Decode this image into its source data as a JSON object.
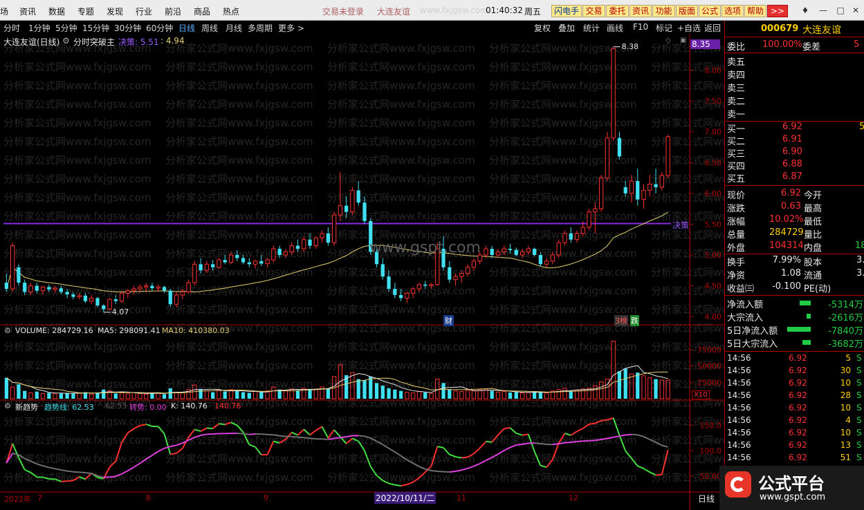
{
  "menubar": {
    "items": [
      "场",
      "资讯",
      "数据",
      "专题",
      "发现",
      "行业",
      "前沿",
      "商品",
      "热点"
    ],
    "status_login": "交易未登录",
    "status_stock": "大连友谊",
    "watermark_url": "www.fxjgsw.com",
    "time": "01:40:32",
    "weekday": "周五",
    "buttons": [
      "闪电手",
      "交易",
      "委托",
      "资讯",
      "功能",
      "版面",
      "公式",
      "选项",
      "帮助",
      ">>"
    ]
  },
  "toolbar": {
    "periods": [
      "分时",
      "1分钟",
      "5分钟",
      "15分钟",
      "30分钟",
      "60分钟",
      "日线",
      "周线",
      "月线",
      "多周期",
      "更多 >"
    ],
    "active_period": "日线",
    "tools": [
      "复权",
      "叠加",
      "统计",
      "画线",
      "F10",
      "标记",
      "+自选",
      "返回"
    ]
  },
  "chart": {
    "title_stock": "大连友谊(日线)",
    "indicator_name": "分时突破主",
    "indicator_param_label": "决策: 5.51",
    "indicator_param2": ": 4.94",
    "price_axis_ticks": [
      "8.00",
      "7.50",
      "7.00",
      "6.50",
      "6.00",
      "5.50",
      "5.00",
      "4.50",
      "4.00"
    ],
    "current_price_tag": "8.35",
    "high_label": "8.38",
    "low_label": "4.07",
    "decision_label": "决策",
    "center_watermark": "www.gspt.com",
    "bg_watermark": "分析家公式网www.fxjgsw.com",
    "markers": [
      "财",
      "3榜",
      "跌"
    ],
    "volume_legend": {
      "volume": "VOLUME: 284729.16",
      "ma5": "MA5: 298091.41",
      "ma10": "MA10: 410380.03"
    },
    "volume_axis_ticks": [
      "75000",
      "50000",
      "25000"
    ],
    "volume_unit": "X10",
    "trend_legend": {
      "name": "新趋势",
      "trendline": "趋势线: 62.53",
      "trendline_ghost": "62.53",
      "turn": "转势: 0.00",
      "k": "K: 140.76",
      "k2": "140.76"
    },
    "trend_axis_ticks": [
      "150.0",
      "100.0",
      "50.00"
    ],
    "date_axis": [
      "2022年",
      "7",
      "8",
      "9",
      "11",
      "12"
    ],
    "cursor_date": "2022/10/11/二",
    "period_label": "日线"
  },
  "colors": {
    "up": "#ff3030",
    "down": "#40e0f0",
    "decision_line": "#8a2be2",
    "ma": "#e6d070",
    "trend_green": "#40e040",
    "trend_magenta": "#e040e0",
    "axis_red": "#b00000"
  },
  "quote": {
    "code": "000679",
    "name": "大连友谊",
    "weibi_label": "委比",
    "weibi_value": "100.00%",
    "weicha_label": "委差",
    "weicha_value": "5",
    "sells": [
      {
        "label": "卖五",
        "price": "",
        "vol": ""
      },
      {
        "label": "卖四",
        "price": "",
        "vol": ""
      },
      {
        "label": "卖三",
        "price": "",
        "vol": ""
      },
      {
        "label": "卖二",
        "price": "",
        "vol": ""
      },
      {
        "label": "卖一",
        "price": "",
        "vol": ""
      }
    ],
    "buys": [
      {
        "label": "买一",
        "price": "6.92",
        "vol": "5"
      },
      {
        "label": "买二",
        "price": "6.91",
        "vol": ""
      },
      {
        "label": "买三",
        "price": "6.90",
        "vol": ""
      },
      {
        "label": "买四",
        "price": "6.88",
        "vol": ""
      },
      {
        "label": "买五",
        "price": "6.87",
        "vol": ""
      }
    ],
    "stats": [
      {
        "l1": "现价",
        "v1": "6.92",
        "c1": "#ff3030",
        "l2": "今开",
        "v2": ""
      },
      {
        "l1": "涨跌",
        "v1": "0.63",
        "c1": "#ff3030",
        "l2": "最高",
        "v2": ""
      },
      {
        "l1": "涨幅",
        "v1": "10.02%",
        "c1": "#ff3030",
        "l2": "最低",
        "v2": ""
      },
      {
        "l1": "总量",
        "v1": "284729",
        "c1": "#ffd000",
        "l2": "量比",
        "v2": ""
      },
      {
        "l1": "外盘",
        "v1": "104314",
        "c1": "#ff3030",
        "l2": "内盘",
        "v2": "18"
      }
    ],
    "stats2": [
      {
        "l1": "换手",
        "v1": "7.99%",
        "l2": "股本",
        "v2": "3."
      },
      {
        "l1": "净资",
        "v1": "1.08",
        "l2": "流通",
        "v2": "3."
      },
      {
        "l1": "收益㈢",
        "v1": "-0.100",
        "l2": "PE(动)",
        "v2": ""
      }
    ],
    "flows": [
      {
        "label": "净流入额",
        "value": "-5314万",
        "bar": 0.25
      },
      {
        "label": "大宗流入",
        "value": "-2616万",
        "bar": 0.1
      },
      {
        "label": "5日净流入额",
        "value": "-7840万",
        "bar": 0.55
      },
      {
        "label": "5日大宗流入",
        "value": "-3682万",
        "bar": 0.2
      }
    ],
    "ticks": [
      {
        "time": "14:56",
        "price": "6.92",
        "vol": "5",
        "side": "S"
      },
      {
        "time": "14:56",
        "price": "6.92",
        "vol": "30",
        "side": "S"
      },
      {
        "time": "14:56",
        "price": "6.92",
        "vol": "10",
        "side": "S"
      },
      {
        "time": "14:56",
        "price": "6.92",
        "vol": "28",
        "side": "S"
      },
      {
        "time": "14:56",
        "price": "6.92",
        "vol": "10",
        "side": "S"
      },
      {
        "time": "14:56",
        "price": "6.92",
        "vol": "4",
        "side": "S"
      },
      {
        "time": "14:56",
        "price": "6.92",
        "vol": "10",
        "side": "S"
      },
      {
        "time": "14:56",
        "price": "6.92",
        "vol": "13",
        "side": "S"
      },
      {
        "time": "14:56",
        "price": "6.92",
        "vol": "51",
        "side": "S"
      }
    ]
  },
  "logo": {
    "title": "公式平台",
    "url": "www.gspt.com"
  },
  "chart_data": {
    "type": "candlestick",
    "ylim": [
      3.9,
      8.5
    ],
    "decision_level": 5.51,
    "candles": [
      [
        4.55,
        4.7,
        4.4,
        4.45
      ],
      [
        4.45,
        5.2,
        4.4,
        5.15
      ],
      [
        4.8,
        4.85,
        4.5,
        4.55
      ],
      [
        4.55,
        4.6,
        4.35,
        4.4
      ],
      [
        4.4,
        4.55,
        4.35,
        4.5
      ],
      [
        4.5,
        4.55,
        4.38,
        4.42
      ],
      [
        4.42,
        4.5,
        4.36,
        4.48
      ],
      [
        4.48,
        4.52,
        4.4,
        4.44
      ],
      [
        4.44,
        4.5,
        4.38,
        4.46
      ],
      [
        4.46,
        4.5,
        4.36,
        4.4
      ],
      [
        4.4,
        4.45,
        4.3,
        4.36
      ],
      [
        4.36,
        4.4,
        4.28,
        4.32
      ],
      [
        4.32,
        4.38,
        4.28,
        4.34
      ],
      [
        4.34,
        4.38,
        4.22,
        4.25
      ],
      [
        4.25,
        4.35,
        4.2,
        4.3
      ],
      [
        4.3,
        4.32,
        4.15,
        4.18
      ],
      [
        4.18,
        4.2,
        4.07,
        4.12
      ],
      [
        4.12,
        4.3,
        4.1,
        4.28
      ],
      [
        4.28,
        4.35,
        4.2,
        4.25
      ],
      [
        4.25,
        4.4,
        4.22,
        4.38
      ],
      [
        4.38,
        4.45,
        4.3,
        4.42
      ],
      [
        4.42,
        4.5,
        4.35,
        4.45
      ],
      [
        4.45,
        4.52,
        4.38,
        4.48
      ],
      [
        4.48,
        4.55,
        4.4,
        4.5
      ],
      [
        4.5,
        4.55,
        4.42,
        4.46
      ],
      [
        4.46,
        4.52,
        4.4,
        4.48
      ],
      [
        4.48,
        4.5,
        4.38,
        4.42
      ],
      [
        4.42,
        4.45,
        4.15,
        4.2
      ],
      [
        4.2,
        4.4,
        4.15,
        4.35
      ],
      [
        4.35,
        4.45,
        4.28,
        4.4
      ],
      [
        4.4,
        4.6,
        4.38,
        4.55
      ],
      [
        4.55,
        4.9,
        4.5,
        4.85
      ],
      [
        4.85,
        4.95,
        4.7,
        4.75
      ],
      [
        4.75,
        4.9,
        4.7,
        4.85
      ],
      [
        4.85,
        4.92,
        4.75,
        4.8
      ],
      [
        4.8,
        4.95,
        4.78,
        4.92
      ],
      [
        4.92,
        5.0,
        4.85,
        4.88
      ],
      [
        4.88,
        5.05,
        4.85,
        5.0
      ],
      [
        5.0,
        5.08,
        4.9,
        4.95
      ],
      [
        4.95,
        5.0,
        4.85,
        4.88
      ],
      [
        4.88,
        4.95,
        4.8,
        4.85
      ],
      [
        4.85,
        4.92,
        4.78,
        4.9
      ],
      [
        4.9,
        5.0,
        4.82,
        4.86
      ],
      [
        4.86,
        4.95,
        4.8,
        4.92
      ],
      [
        4.92,
        5.15,
        4.88,
        5.1
      ],
      [
        5.1,
        5.15,
        4.95,
        5.0
      ],
      [
        5.0,
        5.1,
        4.95,
        5.05
      ],
      [
        5.05,
        5.2,
        5.0,
        5.15
      ],
      [
        5.15,
        5.25,
        5.05,
        5.1
      ],
      [
        5.1,
        5.3,
        5.05,
        5.25
      ],
      [
        5.25,
        5.35,
        5.1,
        5.15
      ],
      [
        5.15,
        5.3,
        5.1,
        5.28
      ],
      [
        5.28,
        5.4,
        5.2,
        5.35
      ],
      [
        5.35,
        5.45,
        5.15,
        5.2
      ],
      [
        5.2,
        5.7,
        5.15,
        5.65
      ],
      [
        5.65,
        6.35,
        5.55,
        5.8
      ],
      [
        5.8,
        5.95,
        5.6,
        5.7
      ],
      [
        5.7,
        6.1,
        5.65,
        6.05
      ],
      [
        6.05,
        6.2,
        5.8,
        5.85
      ],
      [
        5.85,
        5.95,
        5.5,
        5.55
      ],
      [
        5.55,
        5.6,
        5.0,
        5.05
      ],
      [
        5.05,
        5.1,
        4.8,
        4.85
      ],
      [
        4.85,
        4.95,
        4.6,
        4.65
      ],
      [
        4.65,
        4.75,
        4.4,
        4.45
      ],
      [
        4.45,
        4.55,
        4.3,
        4.35
      ],
      [
        4.35,
        4.45,
        4.25,
        4.3
      ],
      [
        4.3,
        4.4,
        4.22,
        4.38
      ],
      [
        4.38,
        4.48,
        4.3,
        4.45
      ],
      [
        4.45,
        4.55,
        4.4,
        4.52
      ],
      [
        4.52,
        4.58,
        4.45,
        4.5
      ],
      [
        4.5,
        4.55,
        4.45,
        4.52
      ],
      [
        4.52,
        5.2,
        4.5,
        5.1
      ],
      [
        5.1,
        5.3,
        4.75,
        4.8
      ],
      [
        4.8,
        4.9,
        4.55,
        4.6
      ],
      [
        4.6,
        4.7,
        4.5,
        4.65
      ],
      [
        4.65,
        4.75,
        4.55,
        4.7
      ],
      [
        4.7,
        4.85,
        4.65,
        4.8
      ],
      [
        4.8,
        4.95,
        4.75,
        4.9
      ],
      [
        4.9,
        5.05,
        4.85,
        5.0
      ],
      [
        5.0,
        5.15,
        4.95,
        5.1
      ],
      [
        5.1,
        5.15,
        4.95,
        5.0
      ],
      [
        5.0,
        5.1,
        4.95,
        5.05
      ],
      [
        5.05,
        5.15,
        5.0,
        5.1
      ],
      [
        5.1,
        5.18,
        5.02,
        5.08
      ],
      [
        5.08,
        5.12,
        4.98,
        5.0
      ],
      [
        5.0,
        5.1,
        4.95,
        5.05
      ],
      [
        5.05,
        5.15,
        5.0,
        5.1
      ],
      [
        5.1,
        5.12,
        4.98,
        5.0
      ],
      [
        5.0,
        5.05,
        4.82,
        4.85
      ],
      [
        4.85,
        4.95,
        4.8,
        4.9
      ],
      [
        4.9,
        5.05,
        4.85,
        5.0
      ],
      [
        5.0,
        5.25,
        4.95,
        5.2
      ],
      [
        5.2,
        5.4,
        5.15,
        5.35
      ],
      [
        5.35,
        5.45,
        5.2,
        5.25
      ],
      [
        5.25,
        5.4,
        5.2,
        5.35
      ],
      [
        5.35,
        5.55,
        5.3,
        5.45
      ],
      [
        5.45,
        5.75,
        5.4,
        5.7
      ],
      [
        5.7,
        5.85,
        5.35,
        5.75
      ],
      [
        5.75,
        6.3,
        5.7,
        6.25
      ],
      [
        6.25,
        7.0,
        6.2,
        6.9
      ],
      [
        6.9,
        8.38,
        6.85,
        8.35
      ],
      [
        6.9,
        7.0,
        6.55,
        6.6
      ],
      [
        6.1,
        6.2,
        5.95,
        6.0
      ],
      [
        6.0,
        6.3,
        5.85,
        6.2
      ],
      [
        6.2,
        6.4,
        5.8,
        5.9
      ],
      [
        5.9,
        6.15,
        5.75,
        6.05
      ],
      [
        6.05,
        6.3,
        5.95,
        6.15
      ],
      [
        6.15,
        6.4,
        6.0,
        6.1
      ],
      [
        6.1,
        6.35,
        6.05,
        6.29
      ],
      [
        6.29,
        6.95,
        6.25,
        6.92
      ]
    ],
    "volume": [
      32000,
      18000,
      22000,
      12000,
      9000,
      11000,
      8000,
      9000,
      7500,
      8000,
      9000,
      8500,
      9000,
      10000,
      7000,
      9500,
      14000,
      12000,
      8000,
      9000,
      7500,
      9500,
      8000,
      7000,
      8500,
      9000,
      7000,
      16000,
      9000,
      10000,
      14000,
      21000,
      15000,
      12000,
      10000,
      13000,
      11000,
      14000,
      12000,
      10000,
      9000,
      11000,
      10000,
      12000,
      18000,
      14000,
      12000,
      15000,
      13000,
      16000,
      15000,
      14000,
      18000,
      15000,
      34000,
      52000,
      36000,
      40000,
      30000,
      28000,
      34000,
      24000,
      20000,
      16000,
      14000,
      12000,
      10000,
      9000,
      11000,
      9500,
      8000,
      30000,
      24000,
      14000,
      12000,
      11000,
      13000,
      12000,
      14000,
      15000,
      12000,
      10000,
      11000,
      9500,
      10000,
      9000,
      9500,
      11000,
      10000,
      9000,
      12000,
      14000,
      16000,
      12000,
      13000,
      15000,
      16000,
      20000,
      26000,
      30000,
      88000,
      42000,
      46000,
      38000,
      40000,
      35000,
      32000,
      30000,
      28500,
      28500
    ],
    "volume_ylim": [
      0,
      95000
    ],
    "trend_ylim": [
      20,
      175
    ]
  }
}
